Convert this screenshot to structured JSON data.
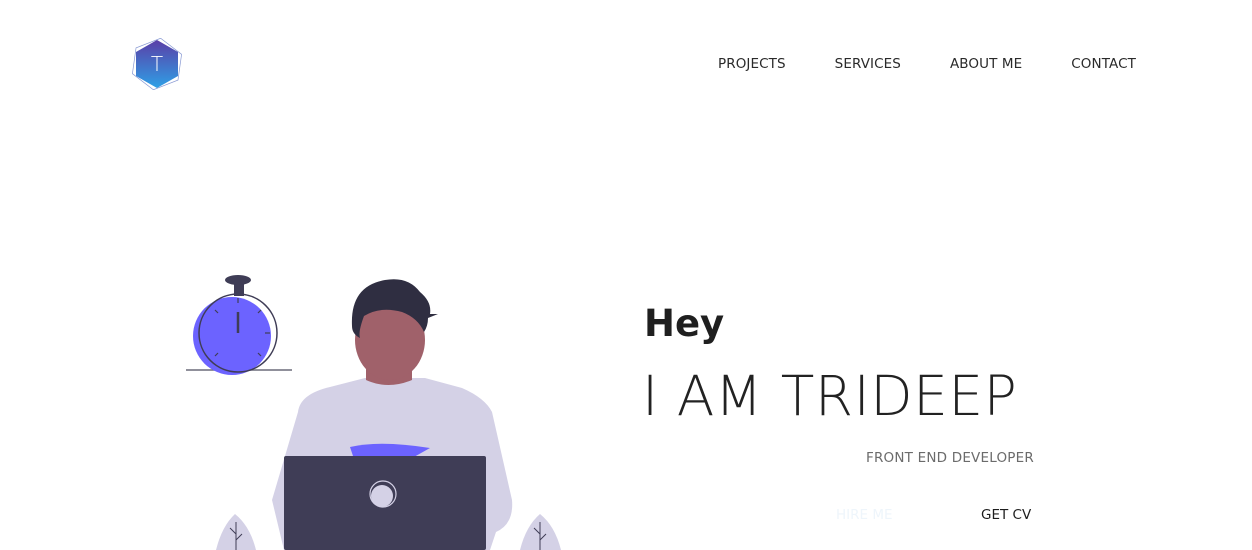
{
  "header": {
    "logo_letter": "T",
    "nav": [
      "PROJECTS",
      "SERVICES",
      "ABOUT ME",
      "CONTACT"
    ]
  },
  "hero": {
    "greeting": "Hey",
    "name": "I AM TRIDEEP",
    "role": "FRONT END DEVELOPER",
    "hire_label": "HIRE ME",
    "cv_label": "GET CV"
  },
  "illustration": {
    "subject": "person-with-laptop",
    "props": [
      "stopwatch-icon",
      "leaf-icon",
      "leaf-icon"
    ]
  },
  "colors": {
    "accent": "#6c63ff",
    "logo_gradient_start": "#5a3ea7",
    "logo_gradient_end": "#2fa0e6",
    "laptop": "#3f3d56",
    "shirt": "#d4d1e6",
    "skin": "#a0616a",
    "hair": "#2f2e41"
  }
}
